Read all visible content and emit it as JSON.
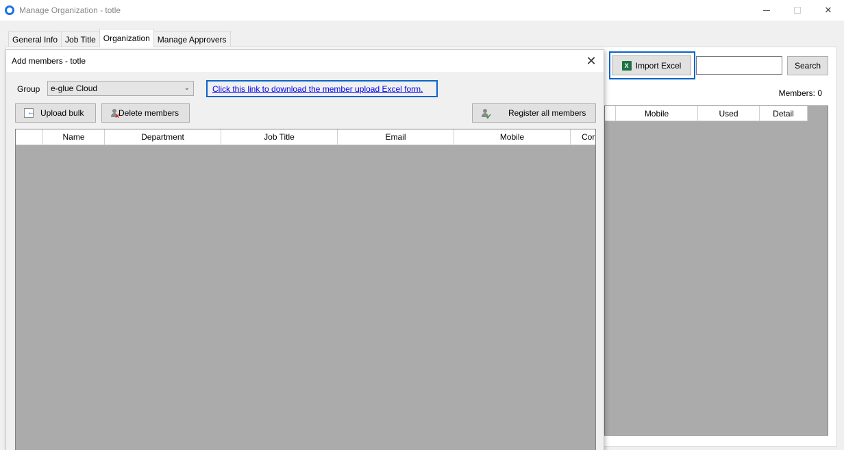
{
  "window": {
    "title": "Manage Organization - totle",
    "min_glyph": "",
    "close_glyph": "✕"
  },
  "tabs": [
    {
      "label": "General Info"
    },
    {
      "label": "Job Title"
    },
    {
      "label": "Organization"
    },
    {
      "label": "Manage Approvers"
    }
  ],
  "toolbar": {
    "import_label": "Import Excel",
    "search_value": "",
    "search_label": "Search",
    "members_count": "Members: 0"
  },
  "right_grid": {
    "columns": [
      "",
      "Mobile",
      "Used",
      "Detail"
    ]
  },
  "dialog": {
    "title": "Add members - totle",
    "close_glyph": "✕",
    "group_label": "Group",
    "group_value": "e-glue Cloud",
    "download_link": "Click this link to download the member upload Excel form.",
    "upload_label": "Upload bulk",
    "delete_label": "Delete members",
    "register_label": "Register all members",
    "columns": [
      "",
      "Name",
      "Department",
      "Job Title",
      "Email",
      "Mobile",
      "Cor"
    ]
  },
  "icons": {
    "app": "app-ring-icon",
    "excel": "excel-icon",
    "excel_letter": "X",
    "upload": "upload-icon",
    "delete": "delete-user-icon",
    "register": "register-user-icon"
  },
  "colors": {
    "focus_border": "#0a64c8",
    "grid_background": "#ababab",
    "link": "#0000ee"
  }
}
